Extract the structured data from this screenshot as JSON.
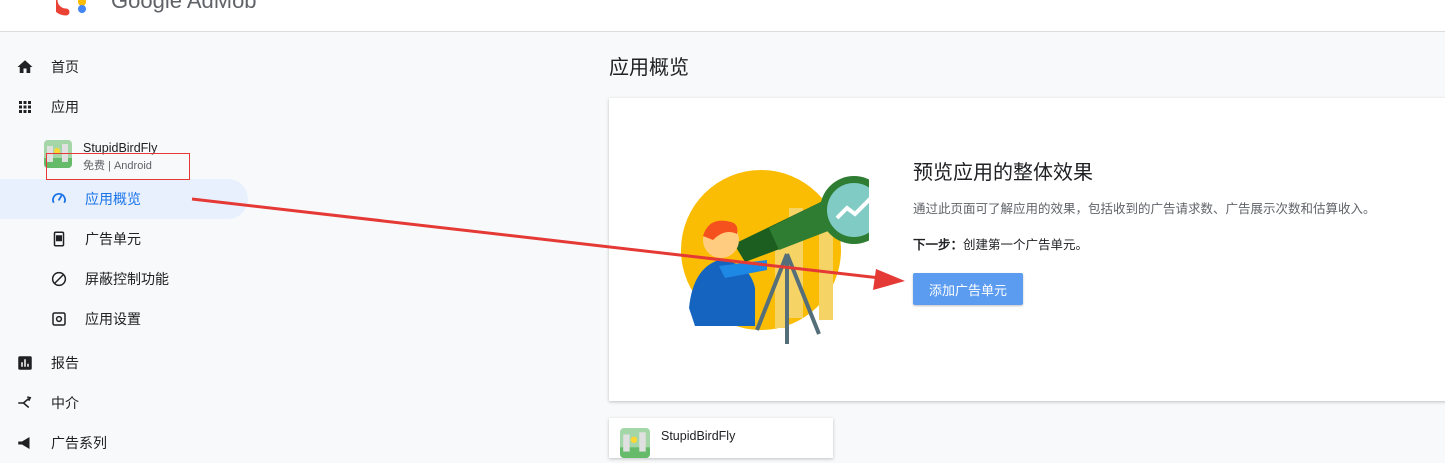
{
  "header": {
    "brand": "Google AdMob",
    "menu_icon": "hamburger-menu-icon",
    "logo_icon": "admob-logo-icon"
  },
  "sidebar": {
    "home": {
      "label": "首页",
      "icon": "home-icon"
    },
    "apps": {
      "label": "应用",
      "icon": "apps-grid-icon"
    },
    "app": {
      "name": "StupidBirdFly",
      "subtitle": "免费 | Android"
    },
    "sub_items": [
      {
        "label": "应用概览",
        "icon": "dashboard-gauge-icon",
        "active": true
      },
      {
        "label": "广告单元",
        "icon": "ad-unit-phone-icon"
      },
      {
        "label": "屏蔽控制功能",
        "icon": "block-icon"
      },
      {
        "label": "应用设置",
        "icon": "settings-icon"
      }
    ],
    "reports": {
      "label": "报告",
      "icon": "bar-chart-icon"
    },
    "mediation": {
      "label": "中介",
      "icon": "mediation-icon"
    },
    "campaigns": {
      "label": "广告系列",
      "icon": "megaphone-icon"
    }
  },
  "main": {
    "page_title": "应用概览",
    "card": {
      "title": "预览应用的整体效果",
      "description": "通过此页面可了解应用的效果，包括收到的广告请求数、广告展示次数和估算收入。",
      "next_step_label": "下一步：",
      "next_step_text": "创建第一个广告单元。",
      "button_label": "添加广告单元"
    },
    "app_card": {
      "name": "StupidBirdFly"
    }
  },
  "colors": {
    "accent": "#1a73e8",
    "button": "#5b9bf0",
    "annotation": "#e53935",
    "active_bg": "#e8f0fe"
  }
}
